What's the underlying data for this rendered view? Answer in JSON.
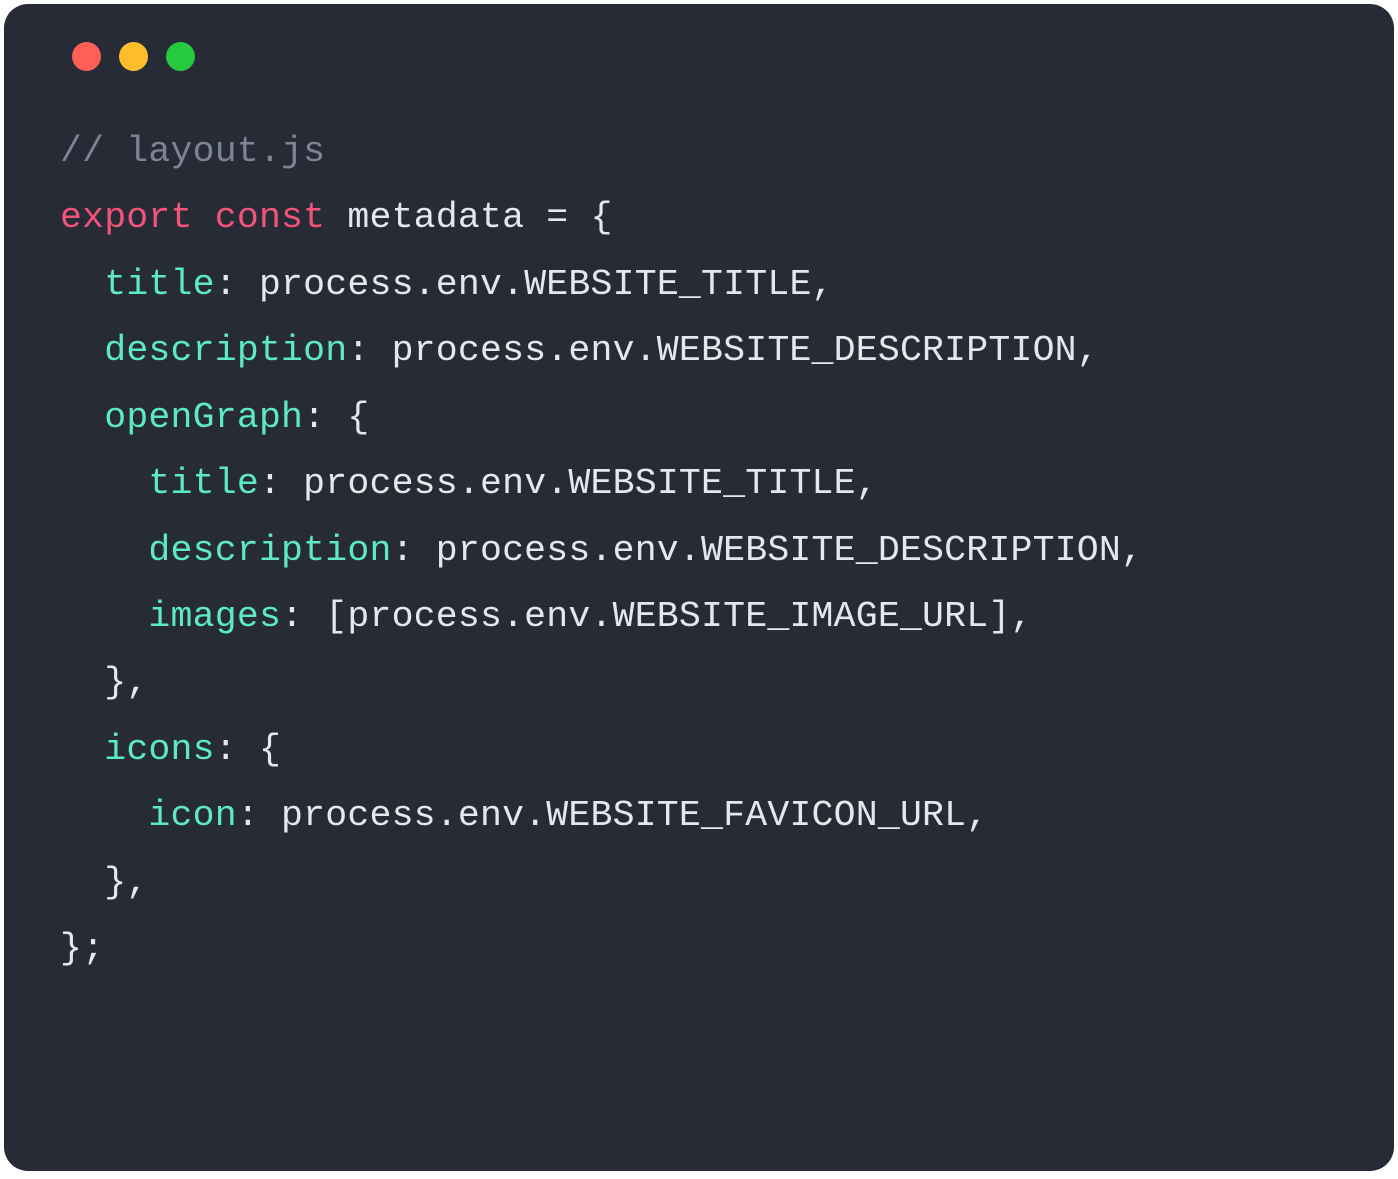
{
  "code": {
    "comment": "// layout.js",
    "line2": {
      "export": "export",
      "const": "const",
      "metadata_eq_brace": " metadata = {"
    },
    "line3": {
      "indent": "  ",
      "title": "title",
      "rest": ": process.env.WEBSITE_TITLE,"
    },
    "line4": {
      "indent": "  ",
      "description": "description",
      "rest": ": process.env.WEBSITE_DESCRIPTION,"
    },
    "line5": {
      "indent": "  ",
      "openGraph": "openGraph",
      "rest": ": {"
    },
    "line6": {
      "indent": "    ",
      "title": "title",
      "rest": ": process.env.WEBSITE_TITLE,"
    },
    "line7": {
      "indent": "    ",
      "description": "description",
      "rest": ": process.env.WEBSITE_DESCRIPTION,"
    },
    "line8": {
      "indent": "    ",
      "images": "images",
      "rest": ": [process.env.WEBSITE_IMAGE_URL],"
    },
    "line9": "  },",
    "line10": {
      "indent": "  ",
      "icons": "icons",
      "rest": ": {"
    },
    "line11": {
      "indent": "    ",
      "icon": "icon",
      "rest": ": process.env.WEBSITE_FAVICON_URL,"
    },
    "line12": "  },",
    "line13": "};"
  }
}
